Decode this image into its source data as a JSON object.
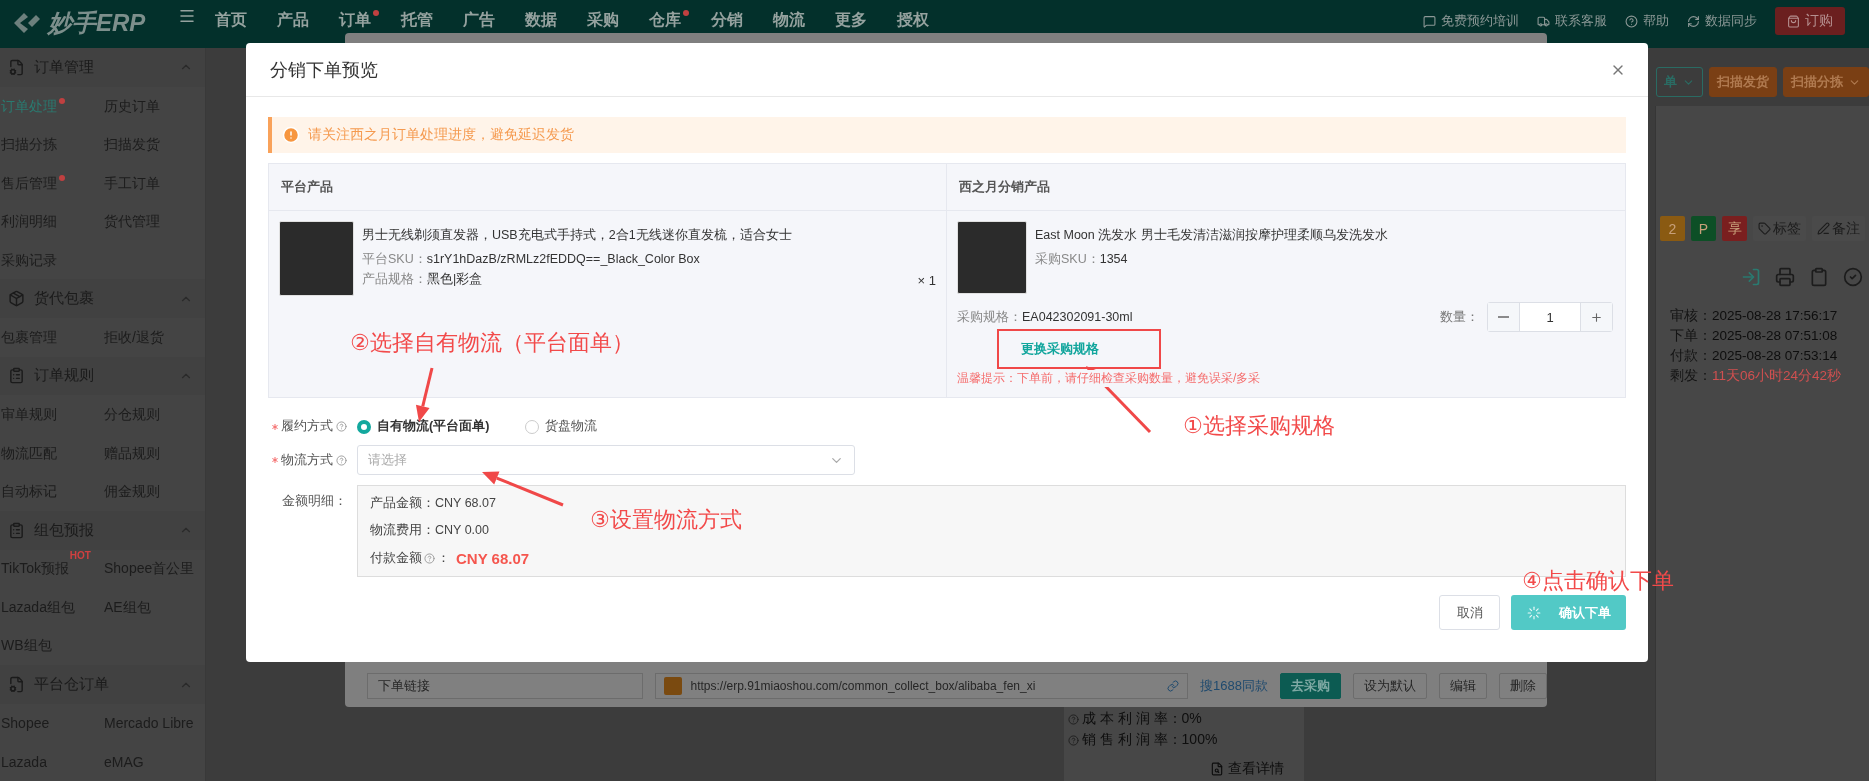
{
  "top_nav": {
    "logo": "妙手ERP",
    "items": [
      {
        "label": "首页",
        "dot": false
      },
      {
        "label": "产品",
        "dot": false
      },
      {
        "label": "订单",
        "dot": true
      },
      {
        "label": "托管",
        "dot": false
      },
      {
        "label": "广告",
        "dot": false
      },
      {
        "label": "数据",
        "dot": false
      },
      {
        "label": "采购",
        "dot": false
      },
      {
        "label": "仓库",
        "dot": true
      },
      {
        "label": "分销",
        "dot": false
      },
      {
        "label": "物流",
        "dot": false
      },
      {
        "label": "更多",
        "dot": false
      },
      {
        "label": "授权",
        "dot": false
      }
    ],
    "right_links": [
      "免费预约培训",
      "联系客服",
      "帮助",
      "数据同步"
    ],
    "order_button": "订购"
  },
  "sidebar": {
    "sections": [
      {
        "title": "订单管理",
        "expanded": true,
        "items": [
          {
            "label": "订单处理",
            "selected": true,
            "dot": true
          },
          {
            "label": "历史订单",
            "selected": false,
            "dot": false
          },
          {
            "label": "扫描分拣",
            "selected": false,
            "dot": false
          },
          {
            "label": "扫描发货",
            "selected": false,
            "dot": false
          },
          {
            "label": "售后管理",
            "selected": false,
            "dot": true
          },
          {
            "label": "手工订单",
            "selected": false,
            "dot": false
          },
          {
            "label": "利润明细",
            "selected": false,
            "dot": false
          },
          {
            "label": "货代管理",
            "selected": false,
            "dot": false
          },
          {
            "label": "采购记录",
            "selected": false,
            "dot": false
          }
        ]
      },
      {
        "title": "货代包裹",
        "expanded": true,
        "items": [
          {
            "label": "包裹管理",
            "selected": false,
            "dot": false
          },
          {
            "label": "拒收/退货",
            "selected": false,
            "dot": false
          }
        ]
      },
      {
        "title": "订单规则",
        "expanded": true,
        "items": [
          {
            "label": "审单规则",
            "selected": false,
            "dot": false
          },
          {
            "label": "分仓规则",
            "selected": false,
            "dot": false
          },
          {
            "label": "物流匹配",
            "selected": false,
            "dot": false
          },
          {
            "label": "赠品规则",
            "selected": false,
            "dot": false
          },
          {
            "label": "自动标记",
            "selected": false,
            "dot": false
          },
          {
            "label": "佣金规则",
            "selected": false,
            "dot": false
          }
        ]
      },
      {
        "title": "组包预报",
        "expanded": true,
        "items": [
          {
            "label": "TikTok预报",
            "selected": false,
            "dot": false,
            "badge": "HOT"
          },
          {
            "label": "Shopee首公里",
            "selected": false,
            "dot": false
          },
          {
            "label": "Lazada组包",
            "selected": false,
            "dot": false
          },
          {
            "label": "AE组包",
            "selected": false,
            "dot": false
          },
          {
            "label": "WB组包",
            "selected": false,
            "dot": false
          }
        ]
      },
      {
        "title": "平台仓订单",
        "expanded": true,
        "items": [
          {
            "label": "Shopee",
            "selected": false,
            "dot": false
          },
          {
            "label": "Mercado Libre",
            "selected": false,
            "dot": false
          },
          {
            "label": "Lazada",
            "selected": false,
            "dot": false
          },
          {
            "label": "eMAG",
            "selected": false,
            "dot": false
          }
        ]
      }
    ]
  },
  "toolbar": {
    "buttons": [
      {
        "label": "单",
        "kind": "outline_dropdown"
      },
      {
        "label": "扫描发货",
        "kind": "solid"
      },
      {
        "label": "扫描分拣",
        "kind": "solid_dropdown"
      }
    ]
  },
  "order_card": {
    "tags": [
      {
        "label": "2",
        "color": "#8a5a12"
      },
      {
        "label": "P",
        "color": "#0d4f26"
      },
      {
        "label": "享",
        "color": "#7a1f1f"
      }
    ],
    "actions": [
      "标签",
      "备注"
    ],
    "times": [
      {
        "label": "审核：",
        "value": "2025-08-28 17:56:17",
        "kind": "normal"
      },
      {
        "label": "下单：",
        "value": "2025-08-28 07:51:08",
        "kind": "normal"
      },
      {
        "label": "付款：",
        "value": "2025-08-28 07:53:14",
        "kind": "normal"
      },
      {
        "label": "剩发：",
        "value": "11天06小时24分42秒",
        "kind": "warning"
      }
    ],
    "profit": [
      {
        "label": "成 本 利 润 率：",
        "value": "0%"
      },
      {
        "label": "销 售 利 润 率：",
        "value": "100%"
      }
    ],
    "detail_link": "查看详情"
  },
  "back_dialog": {
    "link_field": "下单链接",
    "url": "https://erp.91miaoshou.com/common_collect_box/alibaba_fen_xi",
    "search_link": "搜1688同款",
    "buttons": [
      {
        "label": "去采购",
        "kind": "primary"
      },
      {
        "label": "设为默认",
        "kind": "plain"
      },
      {
        "label": "编辑",
        "kind": "plain"
      },
      {
        "label": "删除",
        "kind": "plain"
      }
    ]
  },
  "dialog": {
    "title": "分销下单预览",
    "alert": "请关注西之月订单处理进度，避免延迟发货",
    "columns": [
      "平台产品",
      "西之月分销产品"
    ],
    "platform_product": {
      "title": "男士无线剃须直发器，USB充电式手持式，2合1无线迷你直发梳，适合女士",
      "sku_label": "平台SKU：",
      "sku": "s1rY1hDazB/zRMLz2fEDDQ==_Black_Color Box",
      "spec_label": "产品规格：",
      "spec": "黑色|彩盒",
      "quantity": "× 1"
    },
    "distribution_product": {
      "title": "East Moon 洗发水 男士毛发清洁滋润按摩护理柔顺乌发洗发水",
      "sku_label": "采购SKU：",
      "sku": "1354",
      "spec_label": "采购规格：",
      "spec": "EA042302091-30ml",
      "quantity_label": "数量：",
      "quantity": "1",
      "change_link": "更换采购规格",
      "tip": "温馨提示：下单前，请仔细检查采购数量，避免误采/多采"
    },
    "fulfillment": {
      "label": "履约方式",
      "required": true,
      "options": [
        {
          "label": "自有物流(平台面单)",
          "selected": true
        },
        {
          "label": "货盘物流",
          "selected": false
        }
      ]
    },
    "logistics": {
      "label": "物流方式",
      "required": true,
      "placeholder": "请选择"
    },
    "amount": {
      "label": "金额明细：",
      "lines": [
        {
          "label": "产品金额：",
          "value": "CNY 68.07",
          "kind": "normal"
        },
        {
          "label": "物流费用：",
          "value": "CNY 0.00",
          "kind": "normal"
        },
        {
          "label": "付款金额",
          "separator": "：",
          "value": "CNY 68.07",
          "kind": "total"
        }
      ]
    },
    "cancel_button": "取消",
    "confirm_button": {
      "label": "确认下单",
      "loading": true
    }
  },
  "annotations": [
    {
      "text": "②选择自有物流（平台面单）"
    },
    {
      "text": "①选择采购规格"
    },
    {
      "text": "③设置物流方式"
    },
    {
      "text": "④点击确认下单"
    }
  ]
}
